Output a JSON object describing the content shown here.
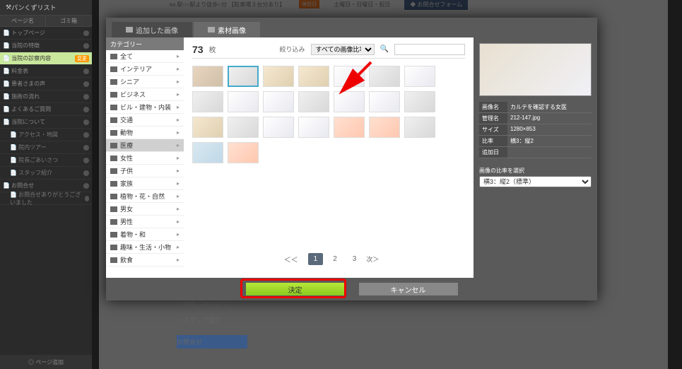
{
  "sidebar": {
    "title": "パンくずリスト",
    "col1": "ページ名",
    "col2": "ゴミ箱",
    "items": [
      {
        "label": "トップページ",
        "active": false
      },
      {
        "label": "当院の特徴",
        "active": false
      },
      {
        "label": "当院の診察内容",
        "active": true,
        "badge": "変更"
      },
      {
        "label": "料金表",
        "active": false
      },
      {
        "label": "患者さまの声",
        "active": false
      },
      {
        "label": "施術の流れ",
        "active": false
      },
      {
        "label": "よくあるご質問",
        "active": false
      },
      {
        "label": "当院について",
        "active": false
      },
      {
        "label": "アクセス・地図",
        "active": false,
        "sub": true
      },
      {
        "label": "院内ツアー",
        "active": false,
        "sub": true
      },
      {
        "label": "院長ごあいさつ",
        "active": false,
        "sub": true
      },
      {
        "label": "スタッフ紹介",
        "active": false,
        "sub": true
      },
      {
        "label": "お問合せ",
        "active": false
      },
      {
        "label": "お問合せありがとうございました",
        "active": false,
        "sub": true
      }
    ],
    "footer": "◎ ページ追加"
  },
  "bg": {
    "address": "ex.駅○○駅より徒歩○分 【駐車場３台分あり】",
    "tag": "休診日",
    "hours": "土曜日・日曜日・祝日",
    "contact_btn": "◆ お問合せフォーム",
    "left_items": [
      "・院長ごあいさつ",
      "・スタッフ紹介"
    ],
    "contact": "お問合せ"
  },
  "modal": {
    "tab1": "追加した画像",
    "tab2": "素材画像",
    "cat_header": "カテゴリー",
    "categories": [
      {
        "label": "全て",
        "active": false
      },
      {
        "label": "インテリア",
        "active": false
      },
      {
        "label": "シニア",
        "active": false
      },
      {
        "label": "ビジネス",
        "active": false
      },
      {
        "label": "ビル・建物・内装",
        "active": false
      },
      {
        "label": "交通",
        "active": false
      },
      {
        "label": "動物",
        "active": false
      },
      {
        "label": "医療",
        "active": true
      },
      {
        "label": "女性",
        "active": false
      },
      {
        "label": "子供",
        "active": false
      },
      {
        "label": "家族",
        "active": false
      },
      {
        "label": "植物・花・自然",
        "active": false
      },
      {
        "label": "男女",
        "active": false
      },
      {
        "label": "男性",
        "active": false
      },
      {
        "label": "着物・和",
        "active": false
      },
      {
        "label": "趣味・生活・小物",
        "active": false
      },
      {
        "label": "飲食",
        "active": false
      }
    ],
    "count": "73",
    "count_label": "枚",
    "filter_label": "絞り込み",
    "filter_value": "すべての画像比率",
    "search_placeholder": "",
    "pagination": {
      "prev": "＜＜",
      "pages": [
        "1",
        "2",
        "3"
      ],
      "active": "1",
      "next": "次＞"
    },
    "detail": {
      "rows": [
        {
          "label": "画像名",
          "value": "カルテを確認する女医"
        },
        {
          "label": "管理名",
          "value": "212-147.jpg"
        },
        {
          "label": "サイズ",
          "value": "1280×853"
        },
        {
          "label": "比率",
          "value": "横3：縦2"
        },
        {
          "label": "追加日",
          "value": ""
        }
      ],
      "ratio_label": "画像の比率を選択",
      "ratio_value": "横3：縦2（標準）"
    },
    "ok": "決定",
    "cancel": "キャンセル"
  }
}
